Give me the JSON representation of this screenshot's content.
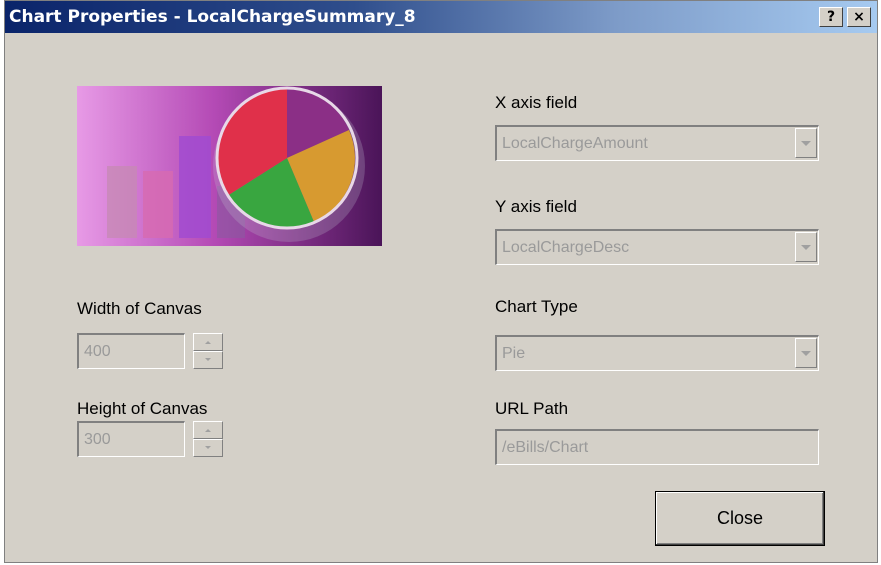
{
  "window": {
    "title": "Chart Properties - LocalChargeSummary_8",
    "help_button": "?",
    "close_button": "×"
  },
  "fields": {
    "x_axis": {
      "label": "X axis field",
      "value": "LocalChargeAmount"
    },
    "y_axis": {
      "label": "Y axis field",
      "value": "LocalChargeDesc"
    },
    "chart_type": {
      "label": "Chart Type",
      "value": "Pie"
    },
    "url_path": {
      "label": "URL Path",
      "value": "/eBills/Chart"
    },
    "canvas_width": {
      "label": "Width of Canvas",
      "value": "400"
    },
    "canvas_height": {
      "label": "Height of Canvas",
      "value": "300"
    }
  },
  "buttons": {
    "close": "Close"
  },
  "colors": {
    "dialog_bg": "#d4d0c8",
    "title_start": "#0a246a",
    "title_end": "#a6caf0",
    "disabled_text": "#9a9a9a"
  },
  "icons": {
    "chart_illustration": "chart-preview-icon",
    "dropdown": "chevron-down-icon",
    "spinner_up": "spin-up-icon",
    "spinner_down": "spin-down-icon"
  }
}
